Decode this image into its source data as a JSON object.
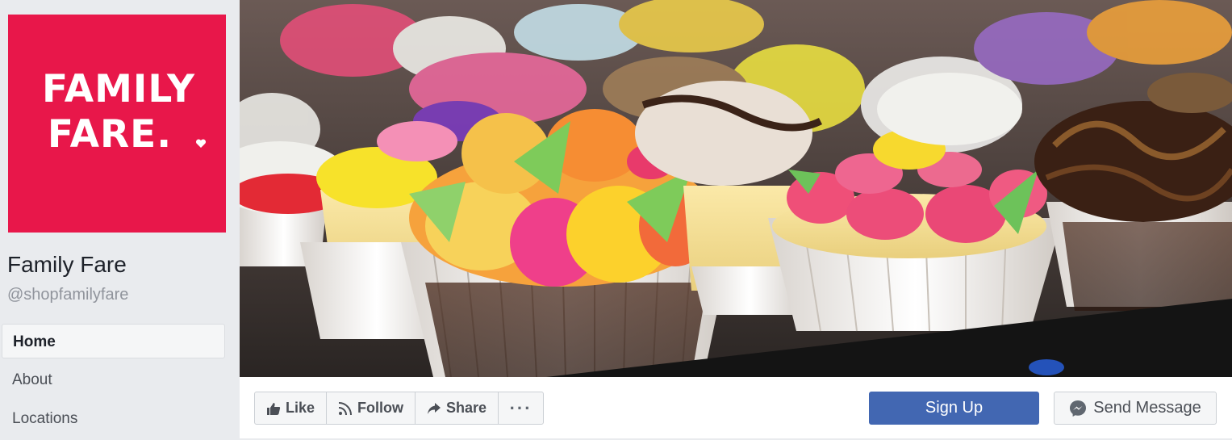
{
  "page": {
    "name": "Family Fare",
    "handle": "@shopfamilyfare",
    "logo_line1": "FAMILY",
    "logo_line2": "FARE."
  },
  "nav": [
    {
      "label": "Home",
      "active": true
    },
    {
      "label": "About",
      "active": false
    },
    {
      "label": "Locations",
      "active": false
    }
  ],
  "actions": {
    "like_label": "Like",
    "follow_label": "Follow",
    "share_label": "Share",
    "more_label": "···",
    "signup_label": "Sign Up",
    "send_message_label": "Send Message"
  },
  "colors": {
    "brand_red": "#e8174a",
    "facebook_blue": "#4267b2"
  },
  "icons": {
    "like": "thumbs-up-icon",
    "follow": "rss-icon",
    "share": "share-arrow-icon",
    "more": "ellipsis-icon",
    "messenger": "messenger-icon"
  }
}
